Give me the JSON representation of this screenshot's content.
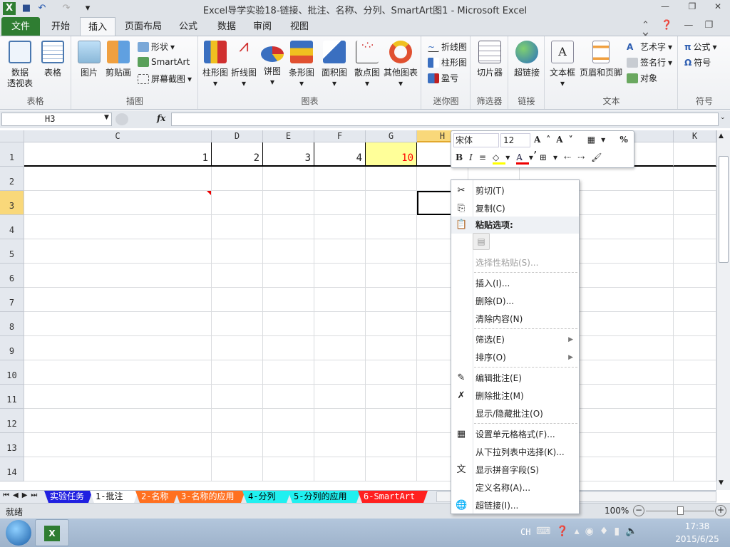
{
  "window": {
    "title": "Excel导学实验18-链接、批注、名称、分列、SmartArt图1 - Microsoft Excel"
  },
  "tabs": [
    {
      "label": "文件"
    },
    {
      "label": "开始"
    },
    {
      "label": "插入"
    },
    {
      "label": "页面布局"
    },
    {
      "label": "公式"
    },
    {
      "label": "数据"
    },
    {
      "label": "审阅"
    },
    {
      "label": "视图"
    }
  ],
  "ribbon": {
    "groups": [
      {
        "label": "表格",
        "items": [
          "数据\n透视表",
          "表格"
        ]
      },
      {
        "label": "插图",
        "items": [
          "图片",
          "剪贴画"
        ],
        "small": [
          "形状",
          "SmartArt",
          "屏幕截图"
        ]
      },
      {
        "label": "图表",
        "items": [
          "柱形图",
          "折线图",
          "饼图",
          "条形图",
          "面积图",
          "散点图",
          "其他图表"
        ]
      },
      {
        "label": "迷你图",
        "small": [
          "折线图",
          "柱形图",
          "盈亏"
        ]
      },
      {
        "label": "筛选器",
        "items": [
          "切片器"
        ]
      },
      {
        "label": "链接",
        "items": [
          "超链接"
        ]
      },
      {
        "label": "文本",
        "items": [
          "文本框",
          "页眉和页脚"
        ],
        "small": [
          "艺术字",
          "签名行",
          "对象"
        ]
      },
      {
        "label": "符号",
        "small": [
          "公式",
          "符号"
        ]
      }
    ]
  },
  "formula_bar": {
    "name_box": "H3",
    "fx": "fx",
    "value": ""
  },
  "columns": [
    "C",
    "D",
    "E",
    "F",
    "G",
    "H",
    "I",
    "J",
    "K"
  ],
  "rows": [
    "1",
    "2",
    "3",
    "4",
    "5",
    "6",
    "7",
    "8",
    "9",
    "10",
    "11",
    "12",
    "13",
    "14"
  ],
  "row1_values": {
    "C": "1",
    "D": "2",
    "E": "3",
    "F": "4",
    "G": "10"
  },
  "colors": {
    "highlight": "#ffff99",
    "red_value": "#ff0000",
    "file_tab": "#2f7d32"
  },
  "mini_toolbar": {
    "font": "宋体",
    "size": "12"
  },
  "context_menu": {
    "items": [
      "剪切(T)",
      "复制(C)",
      "粘贴选项:",
      "选择性粘贴(S)...",
      "插入(I)...",
      "删除(D)...",
      "清除内容(N)",
      "筛选(E)",
      "排序(O)",
      "编辑批注(E)",
      "删除批注(M)",
      "显示/隐藏批注(O)",
      "设置单元格格式(F)...",
      "从下拉列表中选择(K)...",
      "显示拼音字段(S)",
      "定义名称(A)...",
      "超链接(I)..."
    ]
  },
  "sheet_tabs": [
    {
      "label": "实验任务",
      "bg": "#2020e0",
      "fg": "#ffffff"
    },
    {
      "label": "1-批注",
      "bg": "#ffffff",
      "fg": "#000000"
    },
    {
      "label": "2-名称",
      "bg": "#ff7020",
      "fg": "#ffffff"
    },
    {
      "label": "3-名称的应用",
      "bg": "#ff7020",
      "fg": "#ffffff"
    },
    {
      "label": "4-分列",
      "bg": "#20f0f0",
      "fg": "#000000"
    },
    {
      "label": "5-分列的应用",
      "bg": "#20f0f0",
      "fg": "#000000"
    },
    {
      "label": "6-SmartArt图",
      "bg": "#ff2020",
      "fg": "#ffffff"
    }
  ],
  "status": {
    "ready": "就绪",
    "zoom": "100%"
  },
  "taskbar": {
    "lang": "CH",
    "time": "17:38",
    "date": "2015/6/25"
  }
}
